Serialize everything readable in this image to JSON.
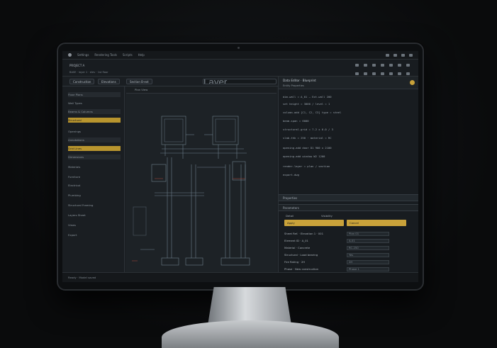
{
  "menubar": {
    "items": [
      "Settings",
      "Rendering Tools",
      "Scripts",
      "Help"
    ],
    "right_icons": [
      "wifi-icon",
      "battery-icon",
      "clock-icon",
      "user-icon"
    ]
  },
  "project": {
    "title": "PROJECT A",
    "subtitle": "BASE · layer 1 · elev · 1st floor"
  },
  "tabs": {
    "tab1": "Construction",
    "tab2": "Elevations",
    "tab3": "Section B-ext",
    "search_placeholder": "Layer"
  },
  "canvas": {
    "label": "Plan View"
  },
  "left_panel": {
    "rows": [
      "Floor Plans",
      "Wall Types",
      "Beams & Columns",
      "Structural",
      "Openings",
      "Annotations",
      "Grid Lines",
      "Dimensions",
      "Materials",
      "Furniture",
      "Electrical",
      "Plumbing",
      "Structural Framing",
      "Layers Sheet",
      "Views",
      "Export"
    ]
  },
  "right_panel": {
    "header": "Data Editor · Blueprint",
    "sub": "Entity Properties",
    "code": [
      "dim.wall = A_01 — Ext.wall 200",
      "  set height = 3000 / level = 1",
      "column.add [C1, C2, C3] type = steel",
      "  beam.span = 6000",
      "structural.grid = 7.2 x 6.0 / 3",
      "  slab.thk = 250 · material = RC",
      "  opening.add door D1 900 x 2100",
      "  opening.add window W2 1200",
      "render.layer = plan / section",
      "export.dwg"
    ],
    "section1": "Properties",
    "section2": "Parameters",
    "btn1": "Apply",
    "btn2": "Cancel",
    "tabs": [
      "Detail",
      "Visibility"
    ],
    "props": [
      {
        "label": "Sheet Ref. · Elevation 1 · 001",
        "value": "Plan 01"
      },
      {
        "label": "Element ID · A_01",
        "value": "A-01"
      },
      {
        "label": "Material · Concrete",
        "value": "RC-250"
      },
      {
        "label": "Structural · Load bearing",
        "value": "Yes"
      },
      {
        "label": "Fire Rating · 2H",
        "value": "2H"
      },
      {
        "label": "Phase · New construction",
        "value": "Phase 1"
      }
    ]
  },
  "statusbar": {
    "text": "Ready · Model saved"
  }
}
